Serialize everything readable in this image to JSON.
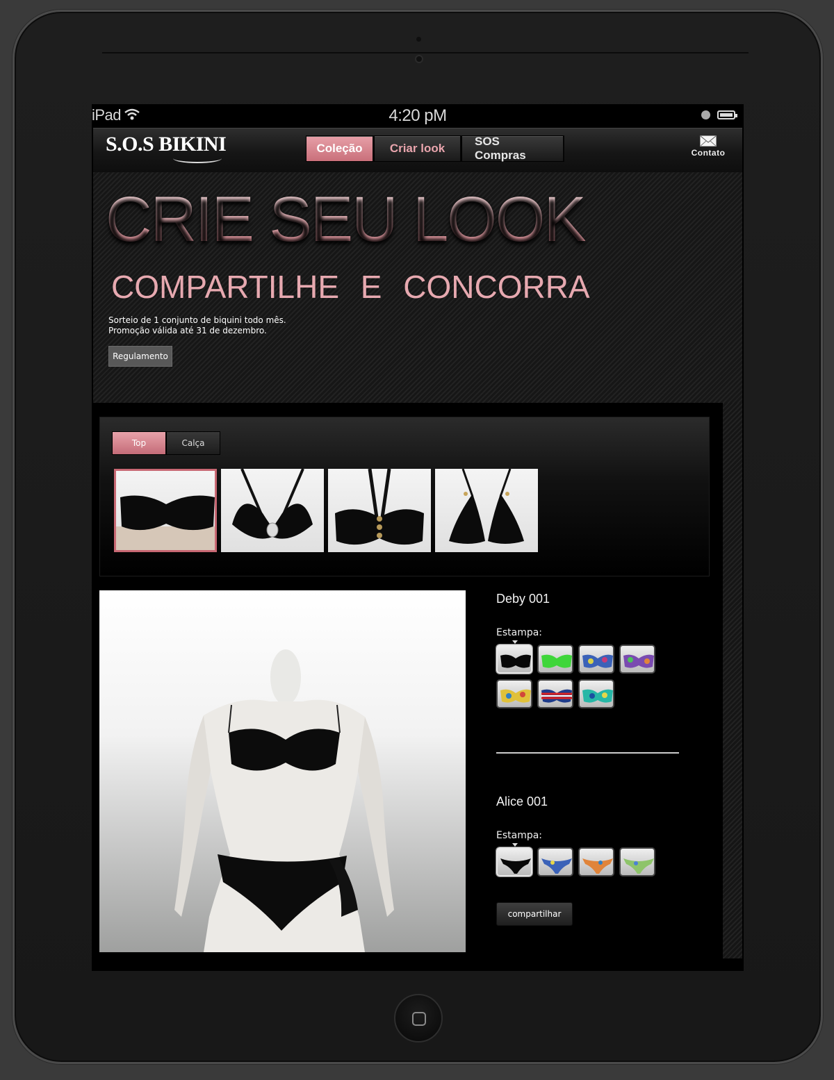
{
  "statusbar": {
    "carrier": "iPad",
    "time": "4:20 pM"
  },
  "header": {
    "logo": "S.O.S BIKINI",
    "nav": [
      "Coleção",
      "Criar look",
      "SOS Compras"
    ],
    "contato": "Contato"
  },
  "hero": {
    "title": "CRIE SEU LOOK",
    "subtitle": "COMPARTILHE E CONCORRA",
    "line1": "Sorteio de 1 conjunto de biquini todo mês.",
    "line2": "Promoção válida até 31 de dezembro.",
    "button": "Regulamento"
  },
  "picker": {
    "tabs": [
      "Top",
      "Calça"
    ]
  },
  "products": [
    {
      "name": "Deby 001",
      "estampa_label": "Estampa:"
    },
    {
      "name": "Alice 001",
      "estampa_label": "Estampa:"
    }
  ],
  "share_button": "compartilhar",
  "colors": {
    "accent": "#c96f7a",
    "accent_light": "#e7a0a8",
    "background": "#000000"
  }
}
